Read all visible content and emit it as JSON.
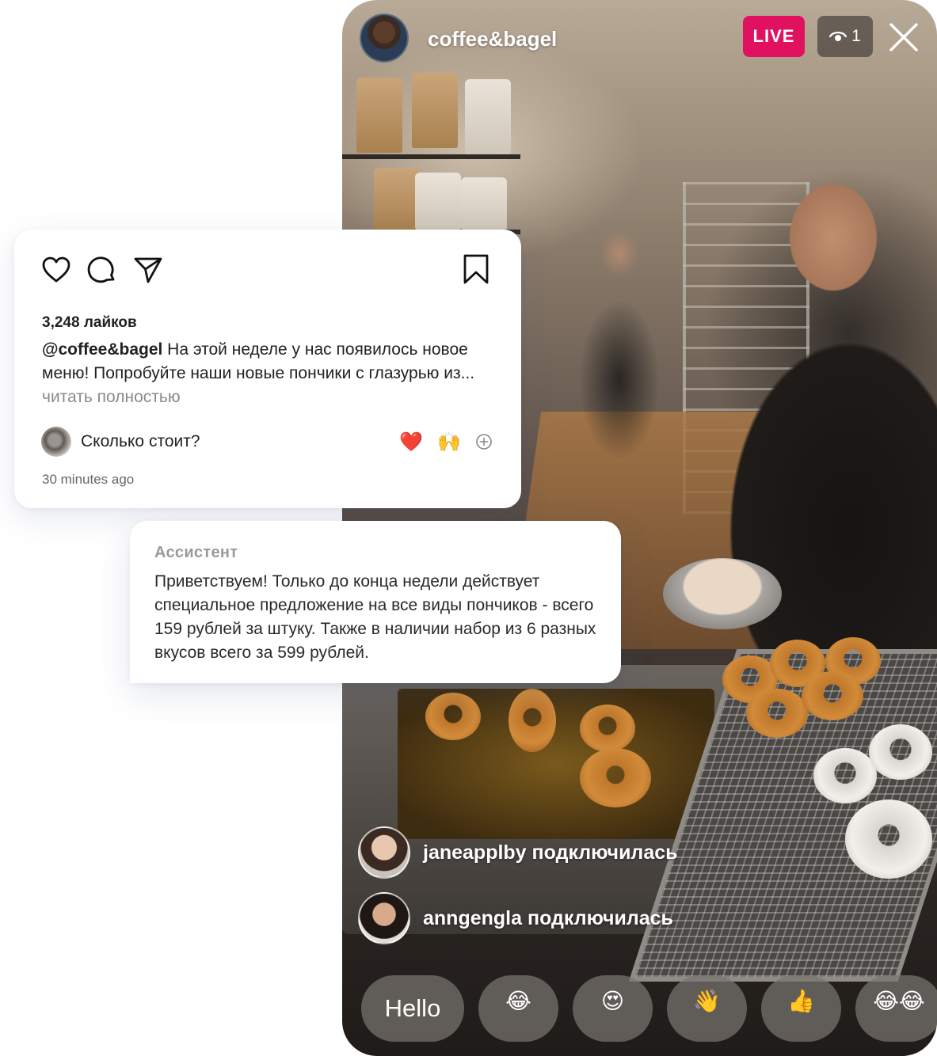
{
  "live": {
    "host_name": "coffee&bagel",
    "live_label": "LIVE",
    "viewer_count": "1",
    "joins": [
      {
        "user": "janeapplby",
        "action": "подключилась"
      },
      {
        "user": "anngengla",
        "action": "подключилась"
      }
    ],
    "quick_replies": [
      "Hello",
      "😂",
      "😍",
      "👋",
      "👍",
      "😂😂"
    ],
    "accent_color": "#e0115f"
  },
  "post": {
    "likes": "3,248 лайков",
    "author": "@coffee&bagel",
    "caption": " На этой неделе у нас появилось новое меню! Попробуйте наши новые пончики с глазурью из...",
    "read_more": " читать полностью",
    "comment": {
      "text": "Сколько стоит?",
      "reactions": [
        "❤️",
        "🙌"
      ]
    },
    "timestamp": "30 minutes ago"
  },
  "assistant": {
    "label": "Ассистент",
    "message": "Приветствуем! Только до конца недели действует специальное предложение на все виды пончиков - всего 159 рублей за штуку. Также в наличии набор из 6 разных вкусов всего за 599 рублей."
  }
}
